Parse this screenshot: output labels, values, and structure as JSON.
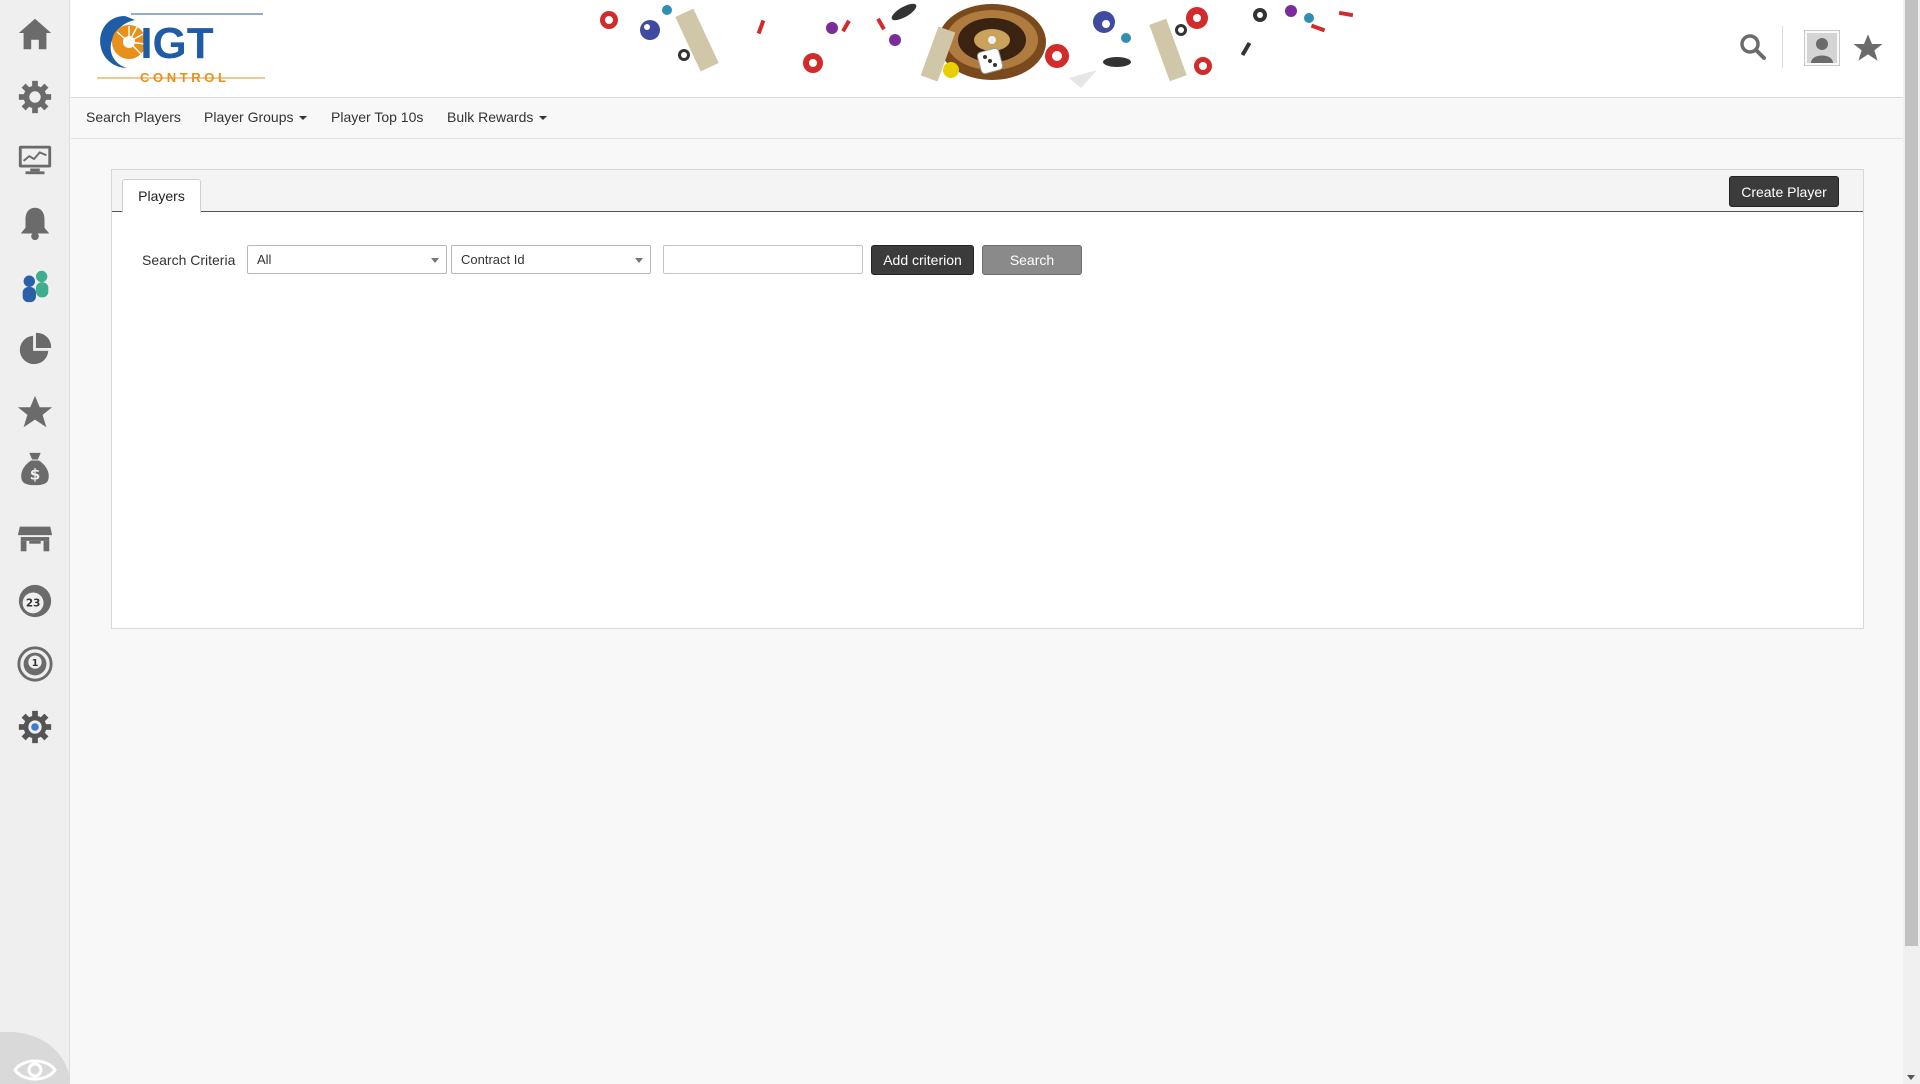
{
  "app": {
    "logo_text": "IGT",
    "logo_subtext": "C O N T R O L"
  },
  "sidebar": {
    "items": [
      {
        "icon": "home-icon"
      },
      {
        "icon": "gear-icon"
      },
      {
        "icon": "monitor-icon"
      },
      {
        "icon": "bell-icon"
      },
      {
        "icon": "players-icon"
      },
      {
        "icon": "pie-chart-icon"
      },
      {
        "icon": "star-icon"
      },
      {
        "icon": "money-bag-icon"
      },
      {
        "icon": "store-icon"
      },
      {
        "icon": "bingo-ball-icon"
      },
      {
        "icon": "token-icon"
      },
      {
        "icon": "settings-gear-icon"
      },
      {
        "icon": "eye-icon"
      }
    ],
    "bingo_ball_number": "23",
    "token_number": "1"
  },
  "header": {
    "search_icon": "search-icon",
    "avatar_icon": "user-avatar-icon",
    "favorite_icon": "star-icon"
  },
  "nav": {
    "search_players": "Search Players",
    "player_groups": "Player Groups",
    "player_top_10s": "Player Top 10s",
    "bulk_rewards": "Bulk Rewards"
  },
  "panel": {
    "tab_label": "Players",
    "create_button": "Create Player",
    "search_criteria_label": "Search Criteria",
    "select_scope": "All",
    "select_field": "Contract Id",
    "criterion_value": "",
    "add_criterion_button": "Add criterion",
    "search_button": "Search"
  },
  "colors": {
    "accent_orange": "#e8901a",
    "logo_blue": "#1f5ca8",
    "dark_button": "#3b3b3b",
    "gray_button": "#8a8a8a",
    "icon_gray": "#6b6b6b"
  }
}
